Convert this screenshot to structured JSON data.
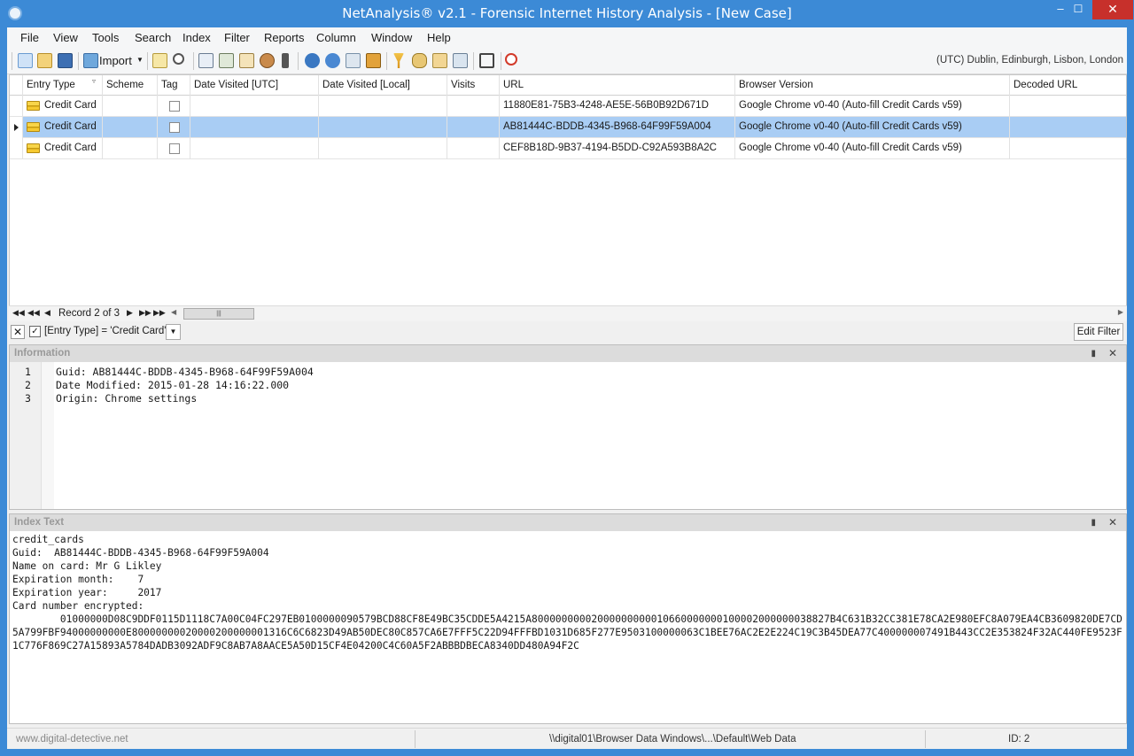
{
  "window": {
    "title": "NetAnalysis® v2.1 - Forensic Internet History Analysis - [New Case]"
  },
  "menu": [
    "File",
    "View",
    "Tools",
    "Search",
    "Index",
    "Filter",
    "Reports",
    "Column",
    "Window",
    "Help"
  ],
  "toolbar": {
    "import_label": "Import",
    "timezone": "(UTC) Dublin, Edinburgh, Lisbon, London"
  },
  "grid": {
    "columns": [
      "Entry Type",
      "Scheme",
      "Tag",
      "Date Visited [UTC]",
      "Date Visited [Local]",
      "Visits",
      "URL",
      "Browser Version",
      "Decoded URL"
    ],
    "rows": [
      {
        "entry_type": "Credit Card",
        "url": "11880E81-75B3-4248-AE5E-56B0B92D671D",
        "browser": "Google Chrome v0-40 (Auto-fill Credit Cards v59)"
      },
      {
        "entry_type": "Credit Card",
        "url": "AB81444C-BDDB-4345-B968-64F99F59A004",
        "browser": "Google Chrome v0-40 (Auto-fill Credit Cards v59)"
      },
      {
        "entry_type": "Credit Card",
        "url": "CEF8B18D-9B37-4194-B5DD-C92A593B8A2C",
        "browser": "Google Chrome v0-40 (Auto-fill Credit Cards v59)"
      }
    ],
    "selected_row": 1
  },
  "navigator": {
    "record_label": "Record 2 of 3"
  },
  "filter": {
    "expression": "[Entry Type] = 'Credit Card'",
    "edit_label": "Edit Filter"
  },
  "info_panel": {
    "title": "Information",
    "lines": [
      {
        "no": "1",
        "text": "Guid: AB81444C-BDDB-4345-B968-64F99F59A004"
      },
      {
        "no": "2",
        "text": "Date Modified: 2015-01-28 14:16:22.000"
      },
      {
        "no": "3",
        "text": "Origin: Chrome settings"
      }
    ]
  },
  "index_panel": {
    "title": "Index Text",
    "text": "credit_cards\nGuid:  AB81444C-BDDB-4345-B968-64F99F59A004\nName on card: Mr G Likley\nExpiration month:    7\nExpiration year:     2017\nCard number encrypted:\n        01000000D08C9DDF0115D1118C7A00C04FC297EB0100000090579BCD88CF8E49BC35CDDE5A4215A80000000002000000000010660000000100002000000038827B4C631B32CC381E78CA2E980EFC8A079EA4CB3609820DE7CD5A799FBF94000000000E80000000020000200000001316C6C6823D49AB50DEC80C857CA6E7FFF5C22D94FFFBD1031D685F277E9503100000063C1BEE76AC2E2E224C19C3B45DEA77C400000007491B443CC2E353824F32AC440FE9523F1C776F869C27A15893A5784DADB3092ADF9C8AB7A8AACE5A50D15CF4E04200C4C60A5F2ABBBDBECA8340DD480A94F2C"
  },
  "statusbar": {
    "website": "www.digital-detective.net",
    "path": "\\\\digital01\\Browser Data Windows\\...\\Default\\Web Data",
    "id": "ID: 2"
  },
  "colors": {
    "titlebar": "#3c8ad6",
    "selected_row": "#a9cdf4",
    "close_button": "#c7302b"
  }
}
